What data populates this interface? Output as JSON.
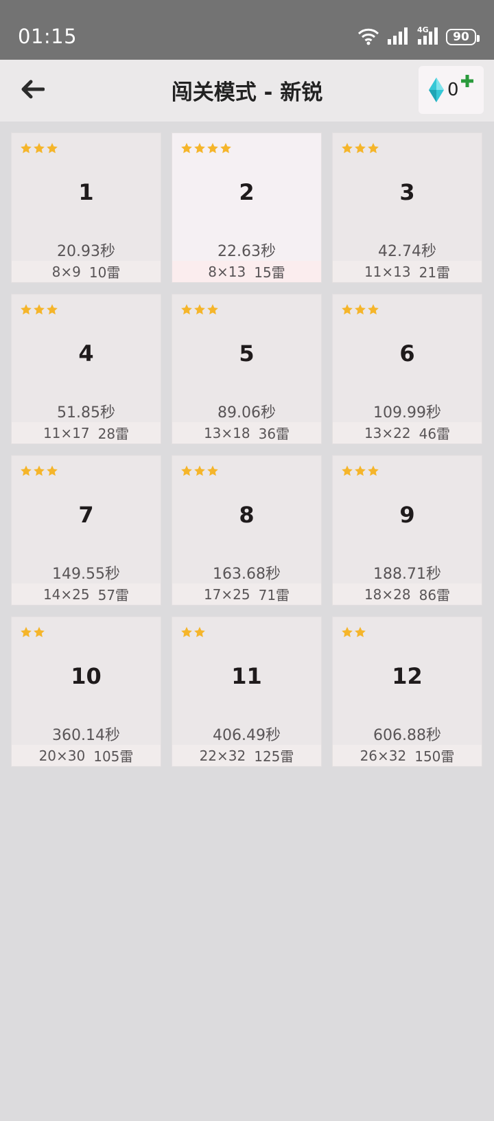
{
  "status": {
    "time": "01:15",
    "network": "4G",
    "battery": "90"
  },
  "header": {
    "title": "闯关模式 - 新锐",
    "gem_count": "0"
  },
  "levels": [
    {
      "num": "1",
      "stars": 3,
      "time": "20.93秒",
      "size": "8×9",
      "mines": "10雷",
      "highlight": false
    },
    {
      "num": "2",
      "stars": 4,
      "time": "22.63秒",
      "size": "8×13",
      "mines": "15雷",
      "highlight": true
    },
    {
      "num": "3",
      "stars": 3,
      "time": "42.74秒",
      "size": "11×13",
      "mines": "21雷",
      "highlight": false
    },
    {
      "num": "4",
      "stars": 3,
      "time": "51.85秒",
      "size": "11×17",
      "mines": "28雷",
      "highlight": false
    },
    {
      "num": "5",
      "stars": 3,
      "time": "89.06秒",
      "size": "13×18",
      "mines": "36雷",
      "highlight": false
    },
    {
      "num": "6",
      "stars": 3,
      "time": "109.99秒",
      "size": "13×22",
      "mines": "46雷",
      "highlight": false
    },
    {
      "num": "7",
      "stars": 3,
      "time": "149.55秒",
      "size": "14×25",
      "mines": "57雷",
      "highlight": false
    },
    {
      "num": "8",
      "stars": 3,
      "time": "163.68秒",
      "size": "17×25",
      "mines": "71雷",
      "highlight": false
    },
    {
      "num": "9",
      "stars": 3,
      "time": "188.71秒",
      "size": "18×28",
      "mines": "86雷",
      "highlight": false
    },
    {
      "num": "10",
      "stars": 2,
      "time": "360.14秒",
      "size": "20×30",
      "mines": "105雷",
      "highlight": false
    },
    {
      "num": "11",
      "stars": 2,
      "time": "406.49秒",
      "size": "22×32",
      "mines": "125雷",
      "highlight": false
    },
    {
      "num": "12",
      "stars": 2,
      "time": "606.88秒",
      "size": "26×32",
      "mines": "150雷",
      "highlight": false
    }
  ],
  "colors": {
    "star": "#f5b52a",
    "gem": "#35c7d6",
    "plus": "#2a9a3c"
  },
  "icons": {
    "back": "arrow-left-icon",
    "gem": "diamond-icon",
    "plus": "plus-icon",
    "star": "star-icon",
    "wifi": "wifi-icon",
    "signal": "signal-icon",
    "battery": "battery-icon"
  }
}
